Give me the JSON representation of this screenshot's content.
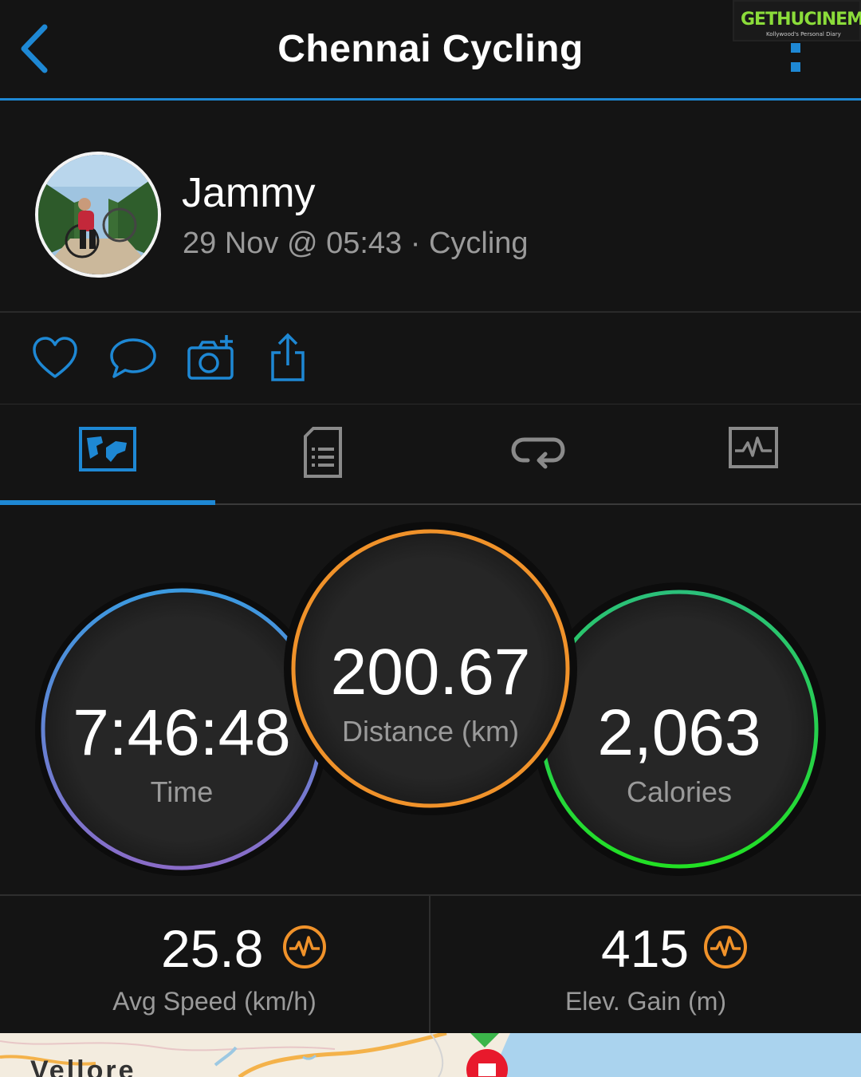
{
  "header": {
    "title": "Chennai Cycling",
    "watermark_brand": "GETHUCINEMA",
    "watermark_tagline": "Kollywood's Personal Diary"
  },
  "profile": {
    "name": "Jammy",
    "meta": "29 Nov @ 05:43 · Cycling"
  },
  "actions": [
    "heart-icon",
    "comment-icon",
    "add-photo-icon",
    "share-icon"
  ],
  "tabs": [
    {
      "icon": "map-tab-icon",
      "active": true
    },
    {
      "icon": "details-tab-icon",
      "active": false
    },
    {
      "icon": "laps-tab-icon",
      "active": false
    },
    {
      "icon": "charts-tab-icon",
      "active": false
    }
  ],
  "stats": {
    "time": {
      "value": "7:46:48",
      "label": "Time"
    },
    "distance": {
      "value": "200.67",
      "label": "Distance (km)"
    },
    "calories": {
      "value": "2,063",
      "label": "Calories"
    }
  },
  "bottom_stats": {
    "avg_speed": {
      "value": "25.8",
      "label": "Avg Speed (km/h)"
    },
    "elev_gain": {
      "value": "415",
      "label": "Elev. Gain (m)"
    }
  },
  "map": {
    "city_label": "Vellore"
  },
  "colors": {
    "accent_blue": "#1e88d4",
    "time_ring_start": "#3b9ae0",
    "time_ring_end": "#8a6cc8",
    "distance_ring": "#f0922a",
    "calories_ring_start": "#2bc07a",
    "calories_ring_end": "#22e024",
    "stat_icon": "#f0922a"
  }
}
